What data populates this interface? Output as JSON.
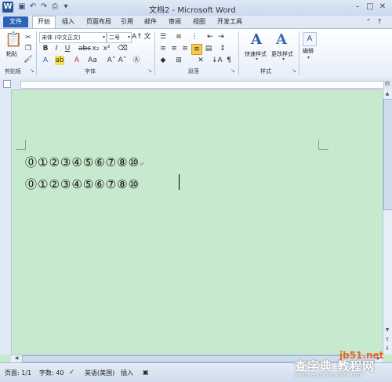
{
  "window": {
    "title": "文档2 - Microsoft Word",
    "logo": "W"
  },
  "quick_access": [
    "save-icon",
    "undo-icon",
    "redo-icon",
    "print-preview-icon",
    "customize-icon"
  ],
  "tabs": [
    "文件",
    "开始",
    "插入",
    "页面布局",
    "引用",
    "邮件",
    "审阅",
    "视图",
    "开发工具"
  ],
  "ribbon": {
    "clipboard": {
      "paste_label": "粘贴",
      "group_label": "剪贴板"
    },
    "font": {
      "font_name": "宋体 (中文正文)",
      "font_size": "二号",
      "group_label": "字体"
    },
    "paragraph": {
      "group_label": "段落"
    },
    "styles": {
      "quick_styles_label": "快速样式",
      "change_styles_label": "更改样式",
      "group_label": "样式"
    },
    "editing": {
      "label": "编辑"
    }
  },
  "document": {
    "lines": [
      {
        "text": "⓪①②③④⑤⑥⑦⑧⑩",
        "mark": "↵"
      },
      {
        "text": "⓪①②③④⑤⑥⑦⑧⑩",
        "mark": ""
      }
    ]
  },
  "status": {
    "page": "页面: 1/1",
    "words": "字数: 40",
    "language": "英语(美国)",
    "mode": "插入"
  },
  "watermark": {
    "site": "jb51.net",
    "big": "查字典 教程网",
    "url": "jiaocheng.chazidian.com"
  },
  "colors": {
    "doc_background": "#c7e9cd",
    "file_tab": "#2a63b8",
    "accent": "#2a5699"
  }
}
